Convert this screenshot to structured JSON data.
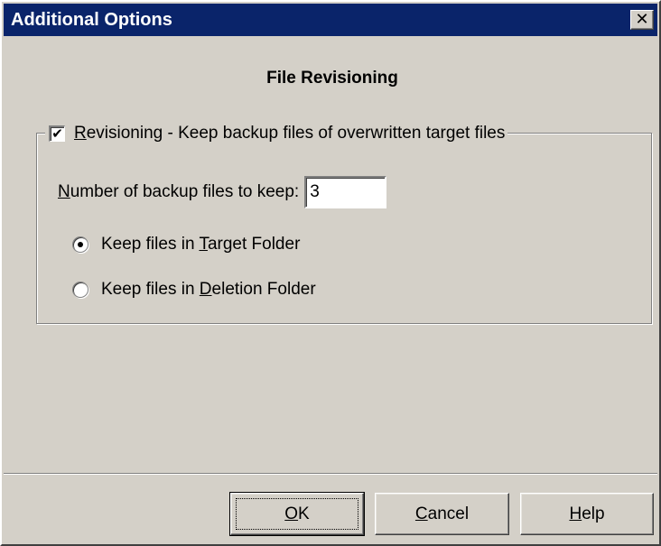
{
  "window": {
    "title": "Additional Options",
    "close_glyph": "✕"
  },
  "section_heading": "File Revisioning",
  "revisioning": {
    "checked": true,
    "check_glyph": "✔",
    "label_prefix": "",
    "label_mnemonic": "R",
    "label_rest": "evisioning - Keep backup files of overwritten target files"
  },
  "backup_count": {
    "label_mnemonic": "N",
    "label_rest": "umber of backup files to keep:",
    "value": "3"
  },
  "location": {
    "selected": "target",
    "options": [
      {
        "id": "target",
        "prefix": "Keep files in ",
        "mnemonic": "T",
        "rest": "arget Folder"
      },
      {
        "id": "deletion",
        "prefix": "Keep files in ",
        "mnemonic": "D",
        "rest": "eletion Folder"
      }
    ]
  },
  "buttons": {
    "ok": {
      "mnemonic": "O",
      "rest": "K"
    },
    "cancel": {
      "mnemonic": "C",
      "rest": "ancel"
    },
    "help": {
      "mnemonic": "H",
      "rest": "elp"
    }
  }
}
